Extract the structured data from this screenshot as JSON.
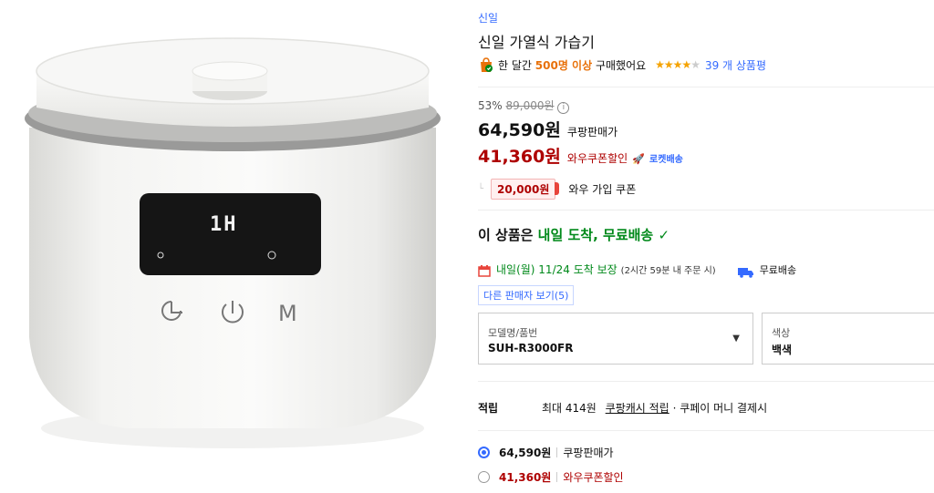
{
  "product": {
    "brand": "신일",
    "title": "신일 가열식 가습기",
    "display_text": "1H"
  },
  "social_proof": {
    "prefix": "한 달간",
    "count": "500명 이상",
    "suffix": "구매했어요",
    "rating_stars": 4.5,
    "reviews": "39 개 상품평"
  },
  "pricing": {
    "discount": "53%",
    "original": "89,000원",
    "sale_price": "64,590원",
    "sale_label": "쿠팡판매가",
    "coupon_price": "41,360원",
    "coupon_label": "와우쿠폰할인",
    "rocket_label": "로켓배송",
    "coupon_amount": "20,000원",
    "coupon_desc": "와우 가입 쿠폰"
  },
  "delivery": {
    "headline_prefix": "이 상품은",
    "headline_highlight": "내일 도착, 무료배송",
    "date_text": "내일(월) 11/24 도착 보장",
    "cutoff": "(2시간 59분 내 주문 시)",
    "free_shipping": "무료배송",
    "other_sellers": "다른 판매자 보기(5)"
  },
  "options": {
    "model_label": "모델명/품번",
    "model_value": "SUH-R3000FR",
    "color_label": "색상",
    "color_value": "백색"
  },
  "rewards": {
    "label": "적립",
    "prefix": "최대 414원",
    "link": "쿠팡캐시 적립",
    "suffix": "· 쿠페이 머니 결제시"
  },
  "price_choices": [
    {
      "price": "64,590원",
      "label": "쿠팡판매가",
      "selected": true
    },
    {
      "price": "41,360원",
      "label": "와우쿠폰할인",
      "selected": false
    }
  ],
  "colors": {
    "accent": "#346aff",
    "coupon_red": "#ae0000",
    "delivery_green": "#00891a",
    "highlight_orange": "#e8710a"
  }
}
